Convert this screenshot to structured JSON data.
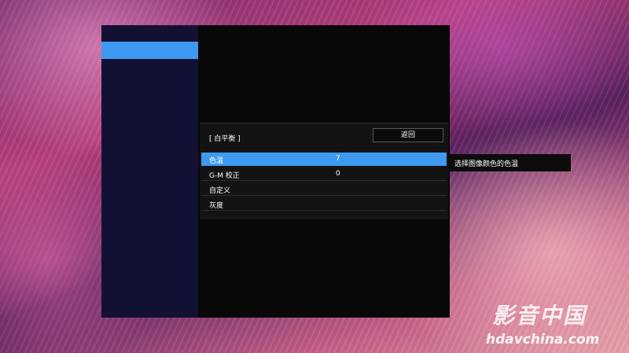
{
  "panel": {
    "title": "[ 白平衡 ]",
    "back_label": "返回",
    "items": [
      {
        "label": "色温",
        "value": "7",
        "selected": true
      },
      {
        "label": "G-M 校正",
        "value": "0",
        "selected": false
      },
      {
        "label": "自定义",
        "value": "",
        "selected": false
      },
      {
        "label": "灰度",
        "value": "",
        "selected": false
      }
    ]
  },
  "tooltip": {
    "text": "选择图像颜色的色温"
  },
  "watermark": {
    "brand": "影音中国",
    "url": "hdavchina.com"
  },
  "colors": {
    "highlight": "#3d9af0",
    "rail": "#131133",
    "panel": "#131313"
  }
}
